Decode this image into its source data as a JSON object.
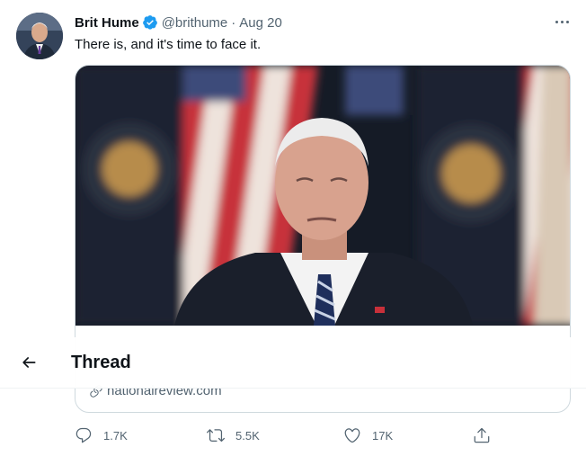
{
  "tweet": {
    "author": {
      "name": "Brit Hume",
      "handle": "@brithume",
      "verified": true,
      "avatar_icon": "profile-photo"
    },
    "separator": "·",
    "date": "Aug 20",
    "text": "There is, and it's time to face it.",
    "more_icon": "ellipsis-icon"
  },
  "card": {
    "image_icon": "photo",
    "domain": "nationalreview.com",
    "link_icon": "link-icon"
  },
  "thread_header": {
    "back_icon": "back-arrow-icon",
    "title": "Thread"
  },
  "actions": {
    "reply_count": "1.7K",
    "retweet_count": "5.5K",
    "like_count": "17K",
    "share_icon": "share-icon"
  },
  "colors": {
    "text": "#0f1419",
    "secondary": "#536471",
    "verified": "#1d9bf0",
    "border": "#cfd9de"
  }
}
